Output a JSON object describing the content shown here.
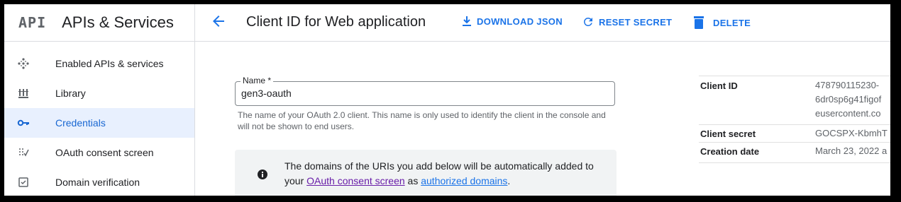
{
  "header": {
    "logo": "API",
    "app_title": "APIs & Services",
    "page_title": "Client ID for Web application",
    "actions": {
      "download": "DOWNLOAD JSON",
      "reset": "RESET SECRET",
      "delete": "DELETE"
    }
  },
  "sidebar": {
    "items": [
      {
        "label": "Enabled APIs & services",
        "icon": "enabled-apis-icon"
      },
      {
        "label": "Library",
        "icon": "library-icon"
      },
      {
        "label": "Credentials",
        "icon": "key-icon",
        "active": true
      },
      {
        "label": "OAuth consent screen",
        "icon": "consent-icon"
      },
      {
        "label": "Domain verification",
        "icon": "checkbox-icon"
      }
    ]
  },
  "form": {
    "name_label": "Name *",
    "name_value": "gen3-oauth",
    "helper_text": "The name of your OAuth 2.0 client. This name is only used to identify the client in the console and will not be shown to end users.",
    "notice": {
      "text_before": "The domains of the URIs you add below will be automatically added to your ",
      "link1": "OAuth consent screen",
      "text_middle": " as ",
      "link2": "authorized domains",
      "text_after": "."
    }
  },
  "client_info": {
    "client_id_label": "Client ID",
    "client_id_lines": [
      "478790115230-",
      "6dr0sp6g41figof",
      "eusercontent.co"
    ],
    "client_secret_label": "Client secret",
    "client_secret_value": "GOCSPX-KbmhT",
    "creation_date_label": "Creation date",
    "creation_date_value": "March 23, 2022 a"
  },
  "colors": {
    "accent": "#1a73e8",
    "active_bg": "#e8f0fe",
    "visited_link": "#681da8"
  }
}
